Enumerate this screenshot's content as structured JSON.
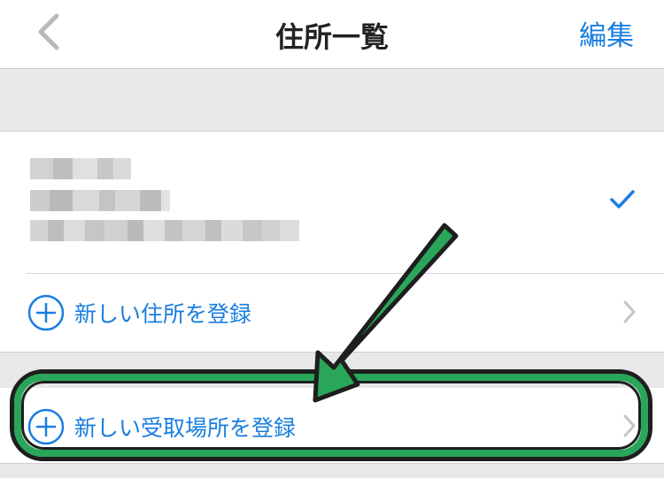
{
  "navbar": {
    "back_icon": "chevron-left-icon",
    "title": "住所一覧",
    "edit_label": "編集"
  },
  "address": {
    "selected_icon": "checkmark-icon"
  },
  "rows": {
    "add_address_label": "新しい住所を登録",
    "add_pickup_label": "新しい受取場所を登録",
    "icon": "plus-circle-icon",
    "chevron_icon": "chevron-right-icon"
  },
  "colors": {
    "accent": "#1a7ee0",
    "highlight_green": "#2aa65a",
    "outline": "#1e1e1e",
    "gray_band": "#e8e8e8"
  }
}
